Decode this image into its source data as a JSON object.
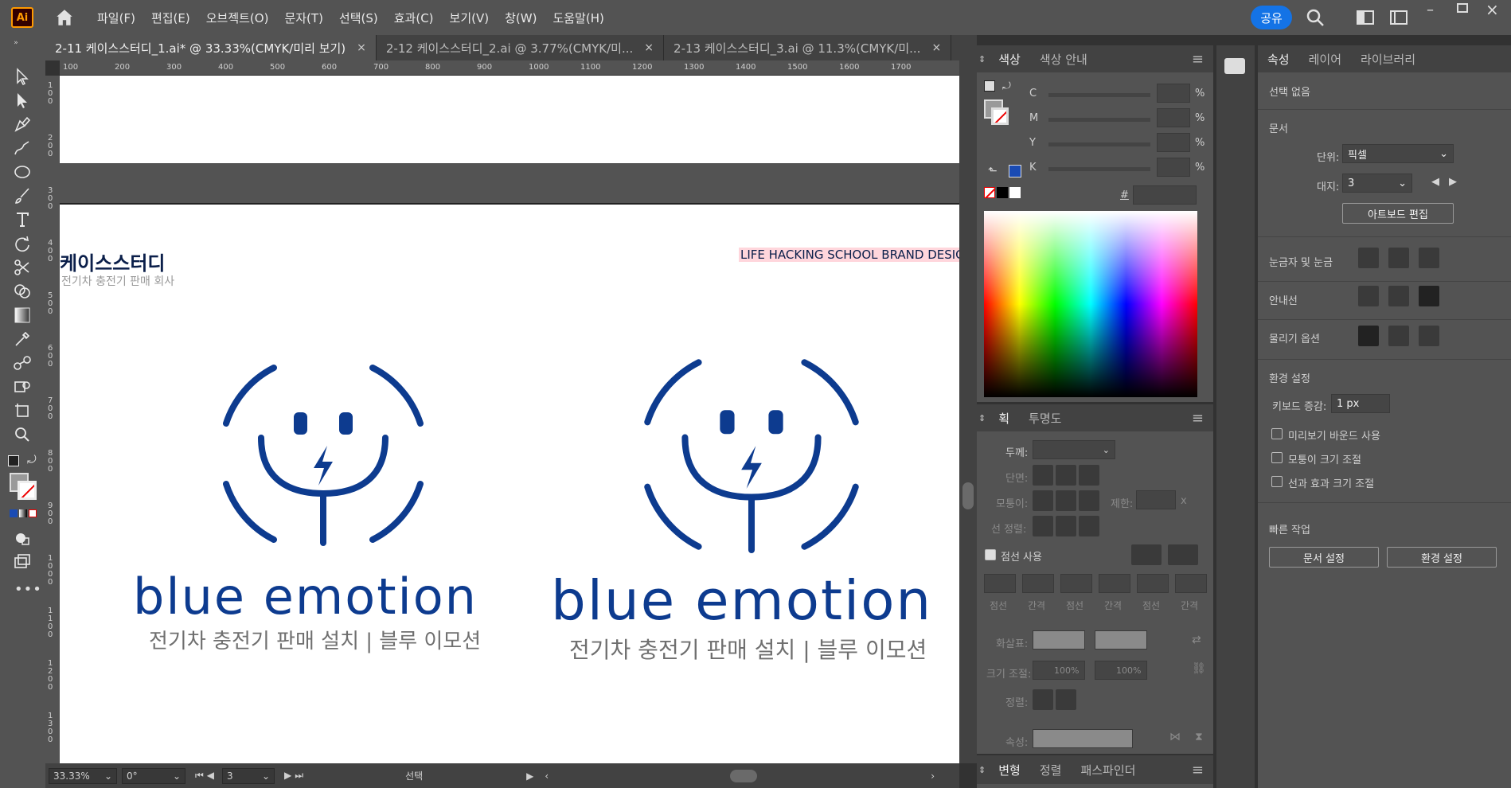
{
  "app": {
    "logo_text": "Ai",
    "share_label": "공유"
  },
  "menu": [
    "파일(F)",
    "편집(E)",
    "오브젝트(O)",
    "문자(T)",
    "선택(S)",
    "효과(C)",
    "보기(V)",
    "창(W)",
    "도움말(H)"
  ],
  "tabs": [
    {
      "label": "2-11 케이스스터디_1.ai* @ 33.33%(CMYK/미리 보기)",
      "close": "×"
    },
    {
      "label": "2-12 케이스스터디_2.ai @ 3.77%(CMYK/미...",
      "close": "×"
    },
    {
      "label": "2-13 케이스스터디_3.ai @ 11.3%(CMYK/미...",
      "close": "×"
    }
  ],
  "ruler": {
    "h": [
      "100",
      "200",
      "300",
      "400",
      "500",
      "600",
      "700",
      "800",
      "900",
      "1000",
      "1100",
      "1200",
      "1300",
      "1400",
      "1500",
      "1600",
      "1700"
    ],
    "v": [
      "100",
      "200",
      "300",
      "400",
      "500",
      "600",
      "700",
      "800",
      "900",
      "1000",
      "1100",
      "1200",
      "1300"
    ]
  },
  "artboard": {
    "title": "케이스스터디",
    "subtitle": "전기차 충전기 판매 회사",
    "tagline": "LIFE HACKING SCHOOL BRAND DESIGN",
    "brand": "blue emotion",
    "brand_sub": "전기차 충전기 판매 설치 | 블루 이모션",
    "accent": "#0d3b8f"
  },
  "status": {
    "zoom": "33.33%",
    "rotate": "0°",
    "artboard_num": "3",
    "mode": "선택"
  },
  "color_panel": {
    "tabs": [
      "색상",
      "색상 안내"
    ],
    "channels": [
      "C",
      "M",
      "Y",
      "K"
    ],
    "unit": "%",
    "hex_label": "#"
  },
  "stroke_panel": {
    "tabs": [
      "획",
      "투명도"
    ],
    "weight_label": "두께:",
    "cap_label": "단면:",
    "corner_label": "모퉁이:",
    "limit_label": "제한:",
    "limit_unit": "x",
    "align_label": "선 정렬:",
    "dashed_label": "점선 사용",
    "dash_labels": [
      "점선",
      "간격",
      "점선",
      "간격",
      "점선",
      "간격"
    ],
    "arrow_label": "화살표:",
    "scale_label": "크기 조절:",
    "scale_values": [
      "100%",
      "100%"
    ],
    "arr_align_label": "정렬:",
    "profile_label": "속성:"
  },
  "bottom_panel": {
    "tabs": [
      "변형",
      "정렬",
      "패스파인더"
    ]
  },
  "properties": {
    "tabs": [
      "속성",
      "레이어",
      "라이브러리"
    ],
    "no_selection": "선택 없음",
    "document": "문서",
    "units_label": "단위:",
    "units_value": "픽셀",
    "artboard_label": "대지:",
    "artboard_value": "3",
    "edit_artboard": "아트보드 편집",
    "rulers_grid": "눈금자 및 눈금",
    "guides": "안내선",
    "snap": "물리기 옵션",
    "prefs": "환경 설정",
    "keyboard_label": "키보드 증감:",
    "keyboard_value": "1 px",
    "checks": [
      "미리보기 바운드 사용",
      "모퉁이 크기 조절",
      "선과 효과 크기 조절"
    ],
    "quick": "빠른 작업",
    "doc_setup": "문서 설정",
    "prefs_btn": "환경 설정"
  }
}
